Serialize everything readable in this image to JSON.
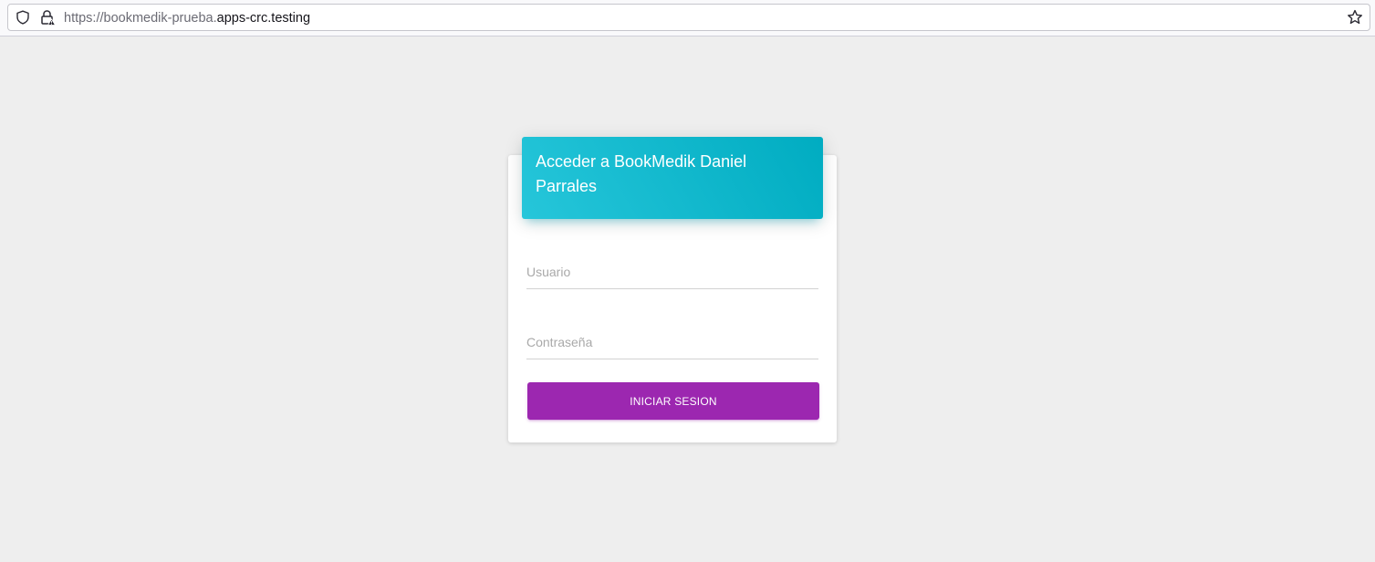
{
  "browser": {
    "url_prefix": "https://bookmedik-prueba.",
    "url_domain": "apps-crc.testing",
    "icons": [
      "shield-icon",
      "insecure-lock-icon",
      "bookmark-star-icon"
    ]
  },
  "login": {
    "title": "Acceder a BookMedik Daniel Parrales",
    "username_placeholder": "Usuario",
    "password_placeholder": "Contraseña",
    "submit_label": "INICIAR SESION"
  },
  "colors": {
    "page_background": "#eeeeee",
    "header_gradient_start": "#26c6da",
    "header_gradient_end": "#00acc1",
    "button": "#9c27b0"
  }
}
